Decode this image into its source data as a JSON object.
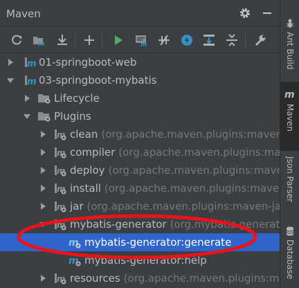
{
  "panel": {
    "title": "Maven",
    "header_icons": [
      "gear-icon",
      "minimize-icon"
    ]
  },
  "toolbar": {
    "buttons": [
      "reload-icon",
      "generate-sources-icon",
      "download-icon",
      "add-icon",
      "run-icon",
      "execute-goal-icon",
      "toggle-offline-icon",
      "skip-tests-icon",
      "show-dependencies-icon",
      "collapse-all-icon",
      "settings-wrench-icon"
    ]
  },
  "tree": {
    "rows": [
      {
        "name": "01-springboot-web",
        "hint": ""
      },
      {
        "name": "03-springboot-mybatis",
        "hint": ""
      },
      {
        "name": "Lifecycle",
        "hint": ""
      },
      {
        "name": "Plugins",
        "hint": ""
      },
      {
        "name": "clean",
        "hint": "(org.apache.maven.plugins:maven-c"
      },
      {
        "name": "compiler",
        "hint": "(org.apache.maven.plugins:maven"
      },
      {
        "name": "deploy",
        "hint": "(org.apache.maven.plugins:maven"
      },
      {
        "name": "install",
        "hint": "(org.apache.maven.plugins:maven-i"
      },
      {
        "name": "jar",
        "hint": "(org.apache.maven.plugins:maven-jar-p"
      },
      {
        "name": "mybatis-generator",
        "hint": "(org.mybatis.generato"
      },
      {
        "name": "mybatis-generator:generate",
        "hint": ""
      },
      {
        "name": "mybatis-generator:help",
        "hint": ""
      },
      {
        "name": "resources",
        "hint": "(org.apache.maven.plugins:maven"
      }
    ]
  },
  "right_bar": {
    "tabs": [
      {
        "label": "Ant Build",
        "icon": "ant-icon"
      },
      {
        "label": "Maven",
        "icon": "maven-m-icon"
      },
      {
        "label": "Json Parser",
        "icon": ""
      },
      {
        "label": "Database",
        "icon": "database-icon"
      }
    ]
  },
  "colors": {
    "background": "#3c3f41",
    "selection": "#2f65ca",
    "annotation": "#e8141c",
    "run_green": "#59a869",
    "maven_blue": "#3592c4"
  }
}
